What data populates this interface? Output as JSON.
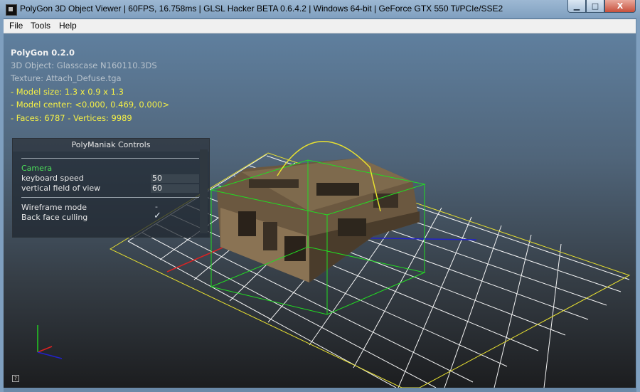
{
  "window": {
    "title": "PolyGon 3D Object Viewer | 60FPS, 16.758ms | GLSL Hacker BETA 0.6.4.2 | Windows 64-bit | GeForce GTX 550 Ti/PCIe/SSE2",
    "minimize_glyph": "▁",
    "maximize_glyph": "□",
    "close_glyph": "X"
  },
  "menu": {
    "file": "File",
    "tools": "Tools",
    "help": "Help"
  },
  "overlay": {
    "app_version": "PolyGon 0.2.0",
    "object": "3D Object: Glasscase N160110.3DS",
    "texture": "Texture: Attach_Defuse.tga",
    "model_size": "- Model size:  1.3 x 0.9 x 1.3",
    "model_center": "- Model center:  <0.000, 0.469, 0.000>",
    "faces_vertices": "- Faces: 6787 - Vertices: 9989"
  },
  "controls": {
    "title": "PolyManiak Controls",
    "section": "Camera",
    "keyboard_speed_label": "keyboard speed",
    "keyboard_speed_value": "50",
    "fov_label": "vertical field of view",
    "fov_value": "60",
    "wireframe_label": "Wireframe mode",
    "wireframe_value": "-",
    "backface_label": "Back face culling",
    "backface_value": "✓"
  },
  "corner": {
    "help_glyph": "?"
  },
  "colors": {
    "info_yellow": "#f4ef46",
    "section_green": "#4de15a",
    "bbox_green": "#22dd22",
    "arc_yellow": "#e8e030",
    "grid_white": "#ffffff"
  }
}
